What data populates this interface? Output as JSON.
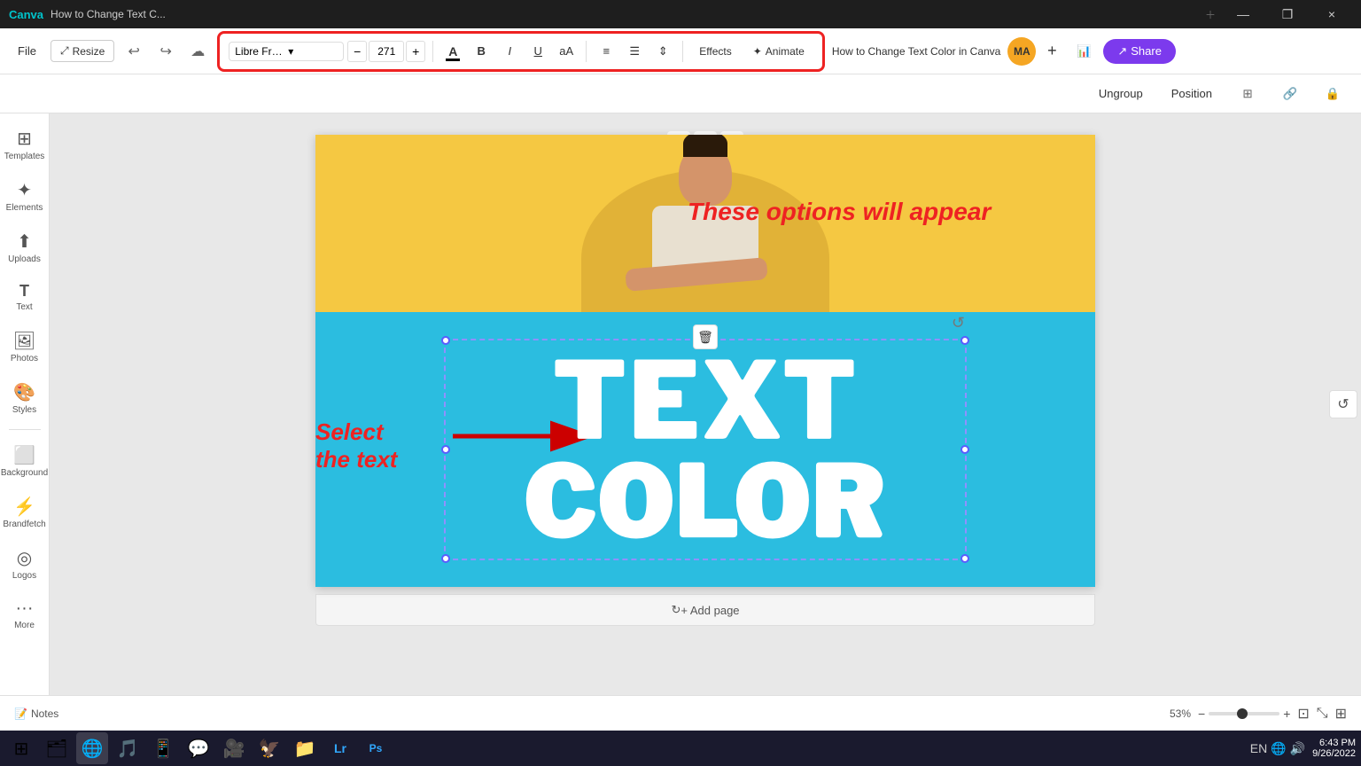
{
  "titlebar": {
    "app": "Canva",
    "tab": "How to Change Text C...",
    "close": "×",
    "restore": "❐",
    "minimize": "—"
  },
  "top_toolbar": {
    "file_label": "File",
    "resize_label": "Resize",
    "undo_symbol": "↩",
    "redo_symbol": "↪",
    "cloud_symbol": "☁",
    "doc_title": "How to Change Text Color in Canva"
  },
  "text_format_toolbar": {
    "font_name": "Libre Franklin Bl...",
    "font_size": "271",
    "decrease_label": "−",
    "increase_label": "+",
    "color_label": "A",
    "bold_label": "B",
    "italic_label": "I",
    "underline_label": "U",
    "case_label": "aA",
    "align_left_label": "≡",
    "list_label": "☰",
    "spacing_label": "⇕",
    "effects_label": "Effects",
    "animate_label": "Animate"
  },
  "secondary_toolbar": {
    "ungroup_label": "Ungroup",
    "position_label": "Position"
  },
  "annotations": {
    "options_text": "These options will appear",
    "select_line1": "Select",
    "select_line2": "the text"
  },
  "canvas": {
    "text_line1": "TEXT",
    "text_line2": "COLOR",
    "delete_icon": "🗑",
    "rotate_icon": "↺"
  },
  "add_page": {
    "label": "+ Add page"
  },
  "status_bar": {
    "notes_label": "Notes",
    "zoom_label": "53%"
  },
  "sidebar": {
    "items": [
      {
        "icon": "⊞",
        "label": "Templates"
      },
      {
        "icon": "✦",
        "label": "Elements"
      },
      {
        "icon": "⬆",
        "label": "Uploads"
      },
      {
        "icon": "T",
        "label": "Text"
      },
      {
        "icon": "📷",
        "label": "Photos"
      },
      {
        "icon": "🎨",
        "label": "Styles"
      },
      {
        "icon": "⬜",
        "label": "Background"
      },
      {
        "icon": "⚡",
        "label": "Brandfetch"
      },
      {
        "icon": "◎",
        "label": "Logos"
      },
      {
        "icon": "•••",
        "label": "More"
      }
    ]
  },
  "taskbar": {
    "icons": [
      "⊞",
      "🗂",
      "🌐",
      "🎵",
      "📱",
      "💬",
      "🦅",
      "📁",
      "🅰",
      "🔵"
    ],
    "time": "6:43 PM",
    "date": "9/26/2022",
    "lang": "EN"
  },
  "share_btn": "Share",
  "avatar_initials": "MA"
}
